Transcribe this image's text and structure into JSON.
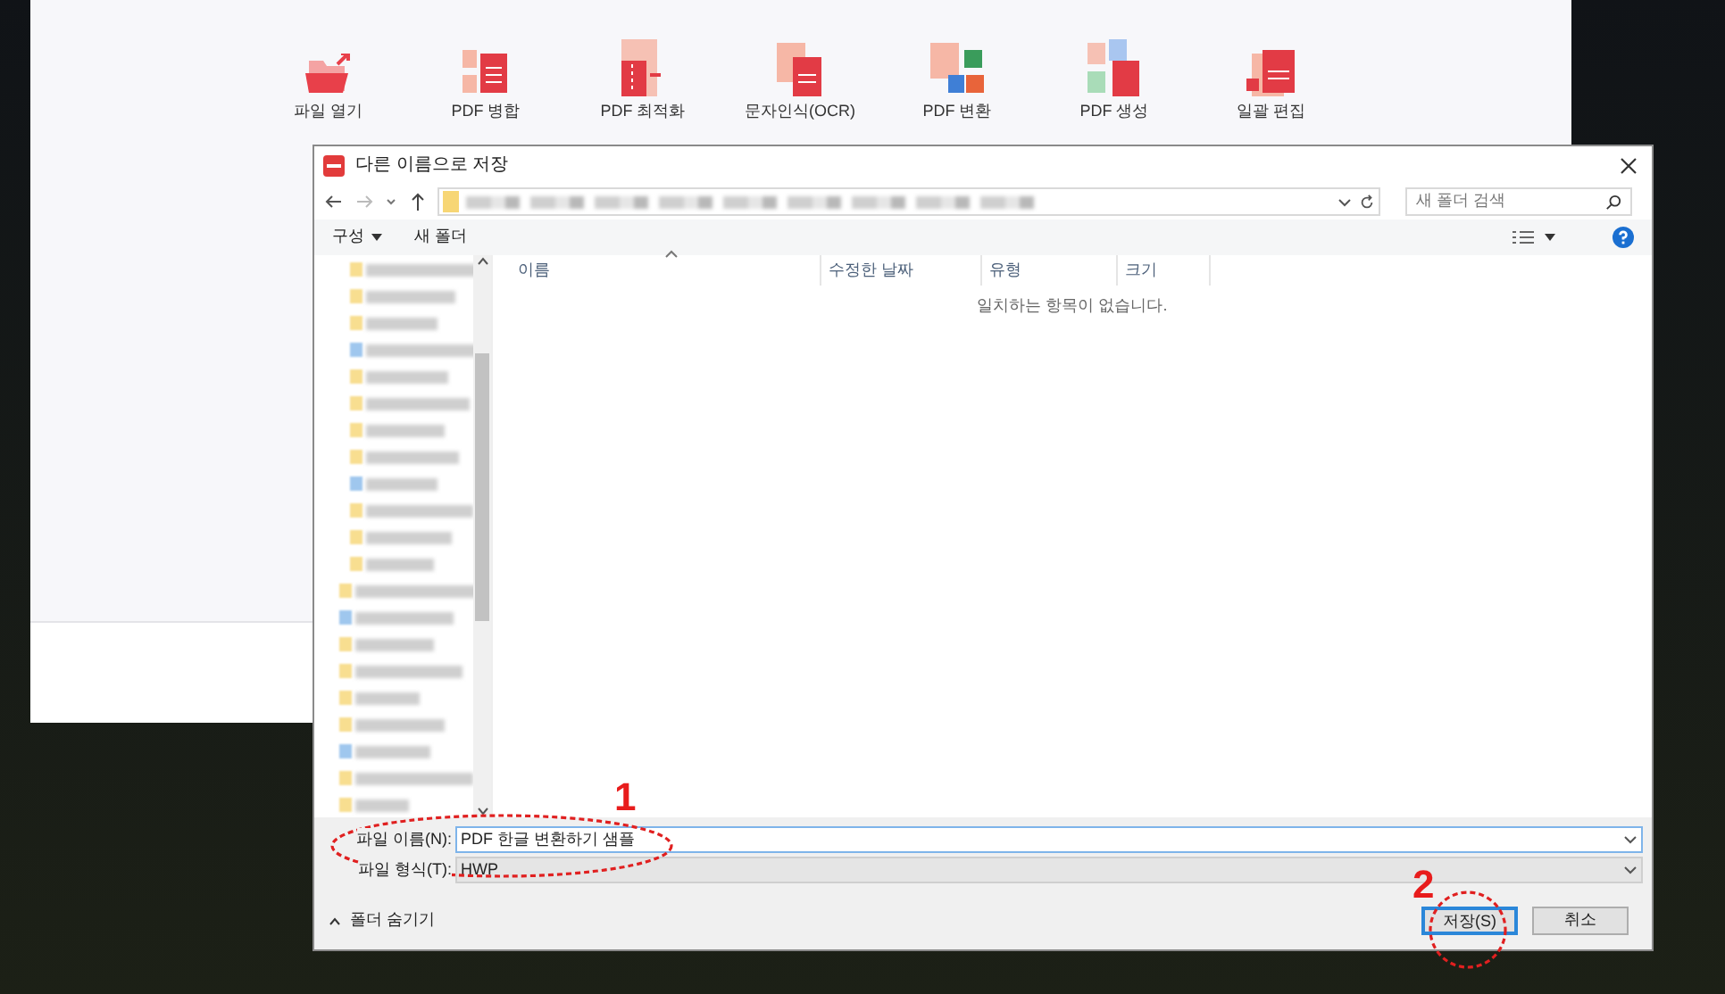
{
  "app": {
    "tools": [
      {
        "label": "파일 열기"
      },
      {
        "label": "PDF 병합"
      },
      {
        "label": "PDF 최적화"
      },
      {
        "label": "문자인식(OCR)"
      },
      {
        "label": "PDF 변환"
      },
      {
        "label": "PDF 생성"
      },
      {
        "label": "일괄 편집"
      }
    ]
  },
  "dialog": {
    "title": "다른 이름으로 저장",
    "search": {
      "placeholder": "새 폴더 검색"
    },
    "toolbar": [
      {
        "label": "구성",
        "kind": "menu"
      },
      {
        "label": "새 폴더",
        "kind": "plain"
      }
    ],
    "columns": [
      "이름",
      "수정한 날짜",
      "유형",
      "크기"
    ],
    "empty_message": "일치하는 항목이 없습니다.",
    "file_name": {
      "label": "파일 이름(N):",
      "value": "PDF 한글 변환하기 샘플"
    },
    "file_type": {
      "label": "파일 형식(T):",
      "value": "HWP"
    },
    "hide_folders": "폴더 숨기기",
    "buttons": [
      {
        "label": "저장(S)",
        "default": true
      },
      {
        "label": "취소",
        "default": false
      }
    ]
  },
  "annotations": [
    "1",
    "2"
  ]
}
